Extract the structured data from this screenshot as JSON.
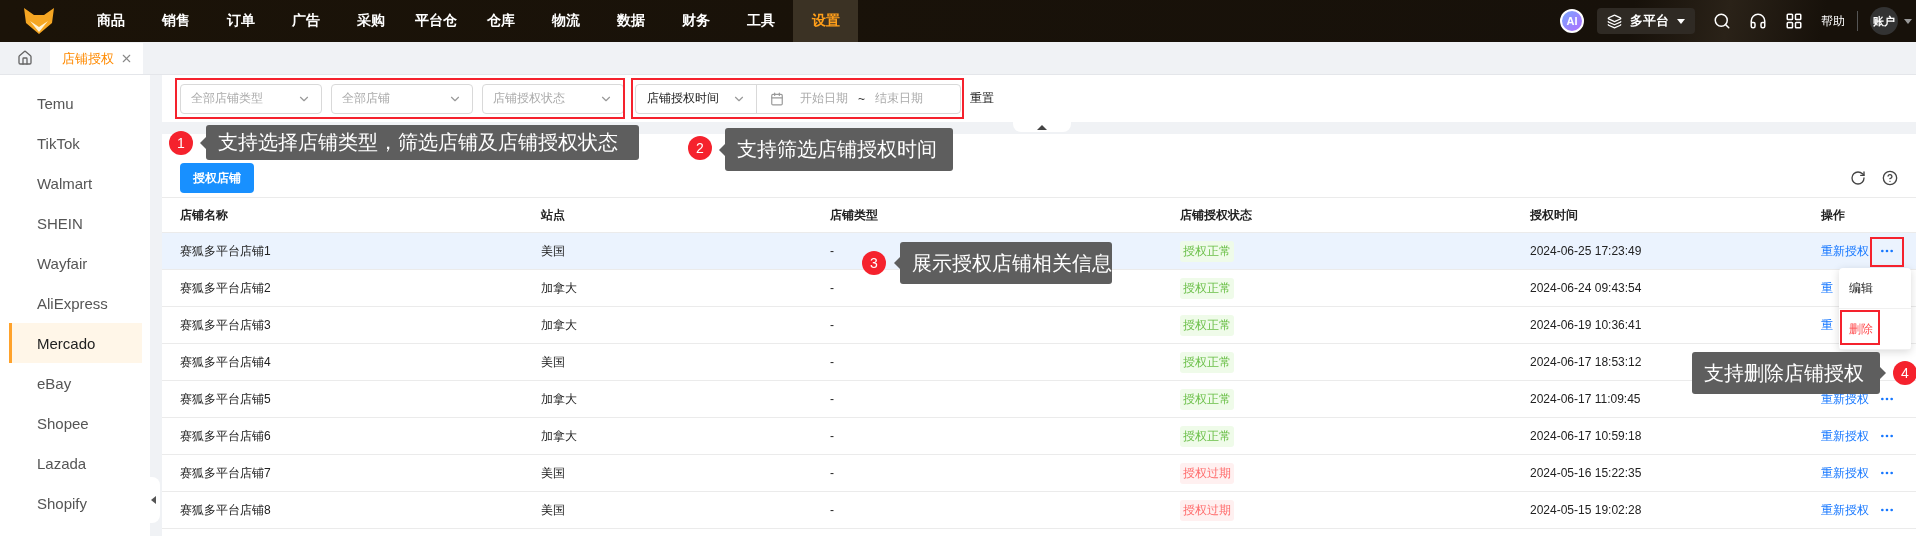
{
  "nav": {
    "items": [
      {
        "label": "商品",
        "selected": false
      },
      {
        "label": "销售",
        "selected": false
      },
      {
        "label": "订单",
        "selected": false
      },
      {
        "label": "广告",
        "selected": false
      },
      {
        "label": "采购",
        "selected": false
      },
      {
        "label": "平台仓",
        "selected": false
      },
      {
        "label": "仓库",
        "selected": false
      },
      {
        "label": "物流",
        "selected": false
      },
      {
        "label": "数据",
        "selected": false
      },
      {
        "label": "财务",
        "selected": false
      },
      {
        "label": "工具",
        "selected": false
      },
      {
        "label": "设置",
        "selected": true
      }
    ],
    "ai_badge": "AI",
    "platform": "多平台",
    "help": "帮助",
    "account": "账户"
  },
  "tabs": [
    {
      "label": "店铺授权",
      "selected": true
    }
  ],
  "sidebar": {
    "items": [
      {
        "label": "Temu",
        "selected": false
      },
      {
        "label": "TikTok",
        "selected": false
      },
      {
        "label": "Walmart",
        "selected": false
      },
      {
        "label": "SHEIN",
        "selected": false
      },
      {
        "label": "Wayfair",
        "selected": false
      },
      {
        "label": "AliExpress",
        "selected": false
      },
      {
        "label": "Mercado",
        "selected": true
      },
      {
        "label": "eBay",
        "selected": false
      },
      {
        "label": "Shopee",
        "selected": false
      },
      {
        "label": "Lazada",
        "selected": false
      },
      {
        "label": "Shopify",
        "selected": false
      }
    ]
  },
  "filters": {
    "selects": [
      {
        "placeholder": "全部店铺类型"
      },
      {
        "placeholder": "全部店铺"
      },
      {
        "placeholder": "店铺授权状态"
      }
    ],
    "time_field": "店铺授权时间",
    "start_placeholder": "开始日期",
    "separator": "~",
    "end_placeholder": "结束日期",
    "reset": "重置"
  },
  "toolbar": {
    "primary_button": "授权店铺"
  },
  "table": {
    "columns": [
      "店铺名称",
      "站点",
      "店铺类型",
      "店铺授权状态",
      "授权时间",
      "操作"
    ],
    "rows": [
      {
        "name": "赛狐多平台店铺1",
        "site": "美国",
        "type": "-",
        "status": {
          "label": "授权正常",
          "kind": "normal"
        },
        "time": "2024-06-25 17:23:49",
        "actions": [
          {
            "kind": "link",
            "label": "重新授权"
          },
          {
            "kind": "more"
          }
        ],
        "selected": true
      },
      {
        "name": "赛狐多平台店铺2",
        "site": "加拿大",
        "type": "-",
        "status": {
          "label": "授权正常",
          "kind": "normal"
        },
        "time": "2024-06-24 09:43:54",
        "actions": [
          {
            "kind": "link",
            "label": "重"
          }
        ],
        "selected": false
      },
      {
        "name": "赛狐多平台店铺3",
        "site": "加拿大",
        "type": "-",
        "status": {
          "label": "授权正常",
          "kind": "normal"
        },
        "time": "2024-06-19 10:36:41",
        "actions": [
          {
            "kind": "link",
            "label": "重"
          }
        ],
        "selected": false
      },
      {
        "name": "赛狐多平台店铺4",
        "site": "美国",
        "type": "-",
        "status": {
          "label": "授权正常",
          "kind": "normal"
        },
        "time": "2024-06-17 18:53:12",
        "selected": false
      },
      {
        "name": "赛狐多平台店铺5",
        "site": "加拿大",
        "type": "-",
        "status": {
          "label": "授权正常",
          "kind": "normal"
        },
        "time": "2024-06-17 11:09:45",
        "actions": [
          {
            "kind": "link",
            "label": "重新授权"
          },
          {
            "kind": "more"
          }
        ],
        "selected": false
      },
      {
        "name": "赛狐多平台店铺6",
        "site": "加拿大",
        "type": "-",
        "status": {
          "label": "授权正常",
          "kind": "normal"
        },
        "time": "2024-06-17 10:59:18",
        "actions": [
          {
            "kind": "link",
            "label": "重新授权"
          },
          {
            "kind": "more"
          }
        ],
        "selected": false
      },
      {
        "name": "赛狐多平台店铺7",
        "site": "美国",
        "type": "-",
        "status": {
          "label": "授权过期",
          "kind": "expired"
        },
        "time": "2024-05-16 15:22:35",
        "actions": [
          {
            "kind": "link",
            "label": "重新授权"
          },
          {
            "kind": "more"
          }
        ],
        "selected": false
      },
      {
        "name": "赛狐多平台店铺8",
        "site": "美国",
        "type": "-",
        "status": {
          "label": "授权过期",
          "kind": "expired"
        },
        "time": "2024-05-15 19:02:28",
        "actions": [
          {
            "kind": "link",
            "label": "重新授权"
          },
          {
            "kind": "more"
          }
        ],
        "selected": false
      }
    ]
  },
  "row_menu": {
    "items": [
      {
        "label": "编辑",
        "kind": "normal"
      },
      {
        "label": "删除",
        "kind": "danger"
      }
    ]
  },
  "callouts": [
    {
      "number": "1",
      "text": "支持选择店铺类型，筛选店铺及店铺授权状态"
    },
    {
      "number": "2",
      "text": "支持筛选店铺授权时间"
    },
    {
      "number": "3",
      "text": "展示授权店铺相关信息"
    },
    {
      "number": "4",
      "text": "支持删除店铺授权"
    }
  ]
}
